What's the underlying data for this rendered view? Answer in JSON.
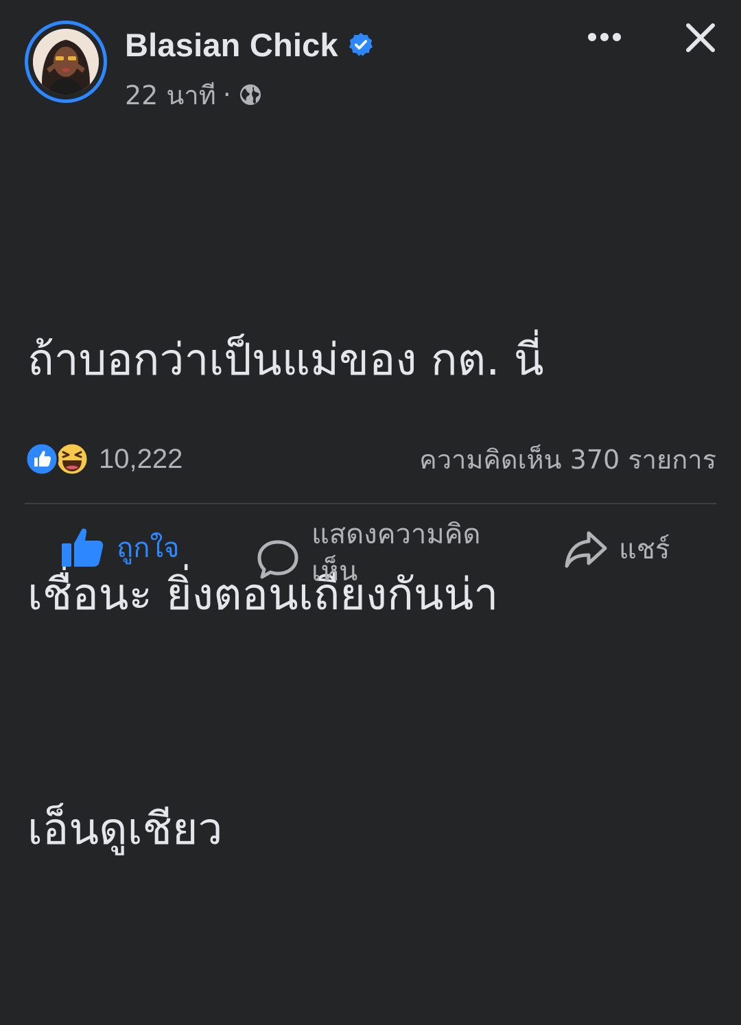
{
  "post": {
    "author": {
      "name": "Blasian Chick",
      "verified": true
    },
    "timestamp": "22 นาที",
    "separator": "·",
    "privacy_icon": "globe-icon",
    "text_lines": [
      "ถ้าบอกว่าเป็นแม่ของ กต. นี่",
      "เชื่อนะ ยิ่งตอนเถียงกันน่า",
      "เอ็นดูเชียว"
    ],
    "reactions": {
      "types": [
        "like-reaction-icon",
        "haha-reaction-icon"
      ],
      "count": "10,222"
    },
    "comments_count": "ความคิดเห็น 370 รายการ"
  },
  "actions": {
    "like_label": "ถูกใจ",
    "comment_label": "แสดงความคิดเห็น",
    "share_label": "แชร์"
  },
  "colors": {
    "background": "#242526",
    "text": "#e4e6eb",
    "secondary_text": "#b0b3b8",
    "accent_blue": "#2d88ff",
    "divider": "#3e4042"
  }
}
